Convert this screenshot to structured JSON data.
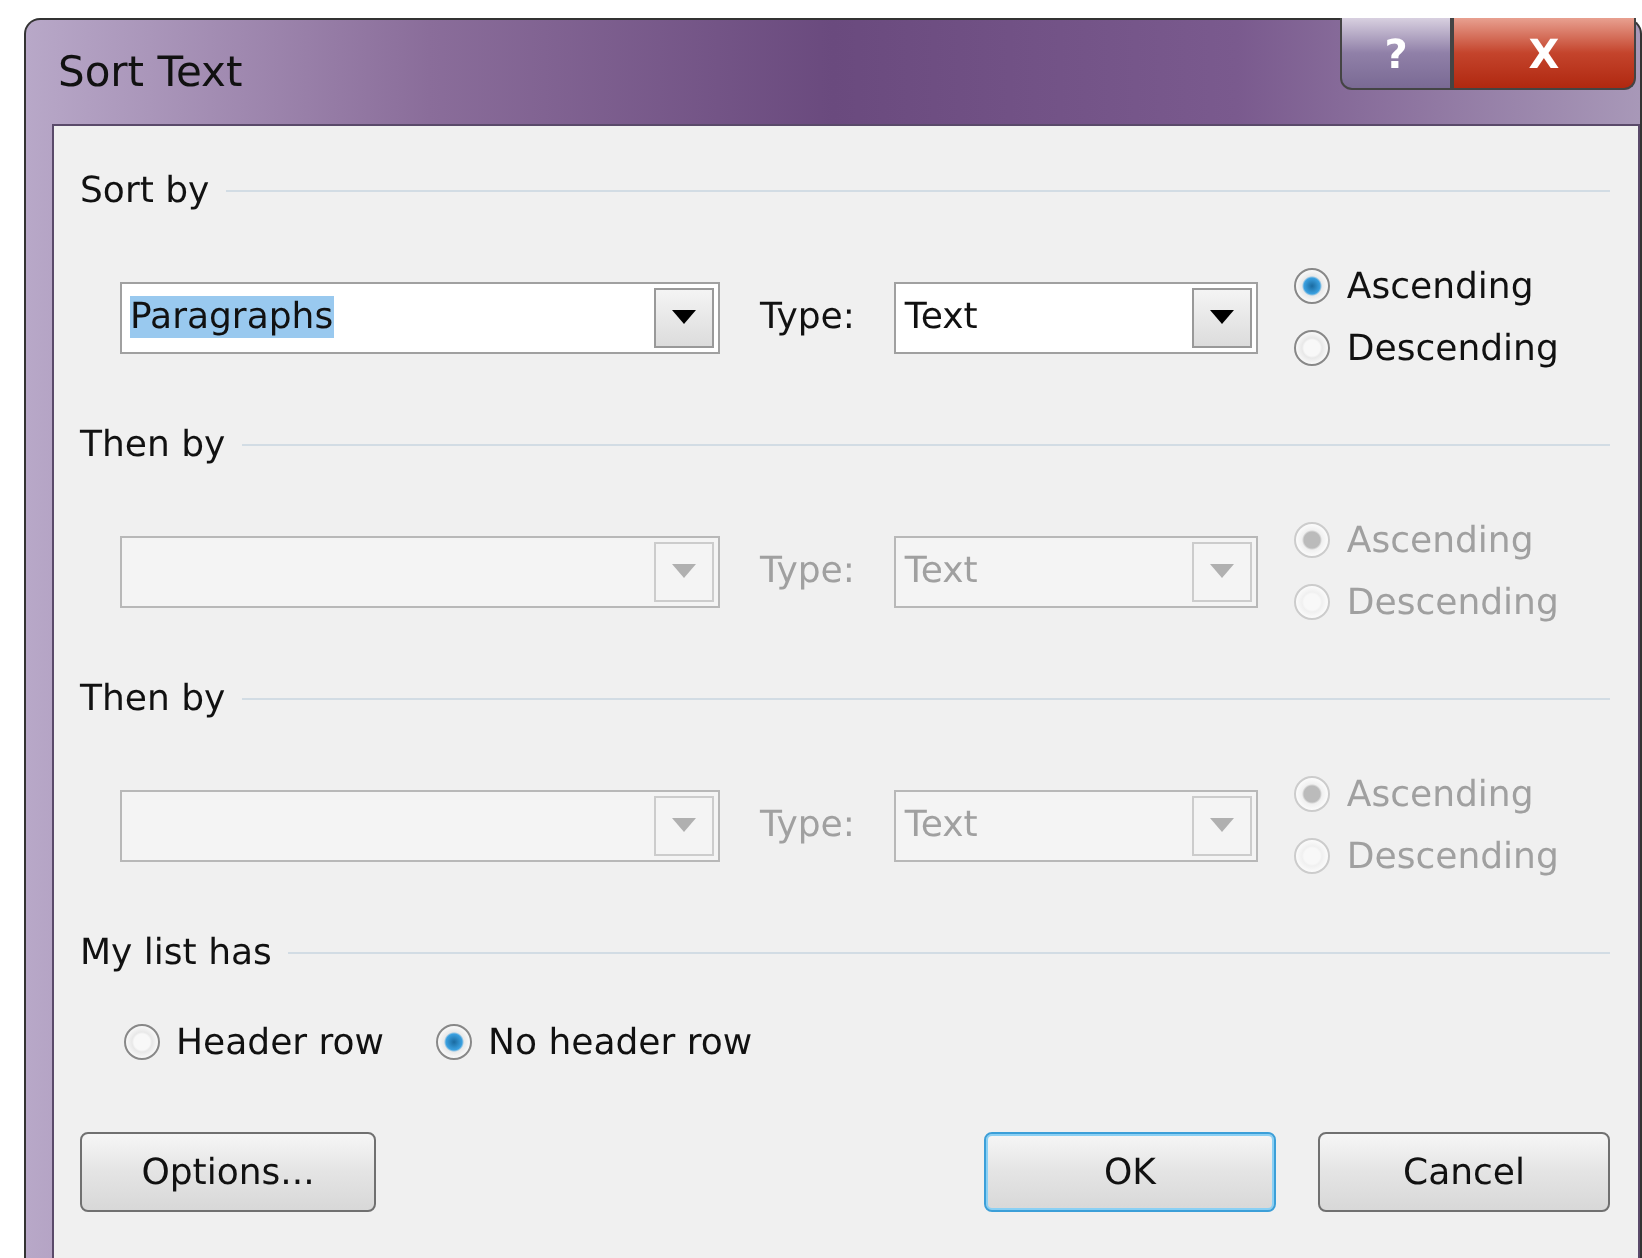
{
  "window": {
    "title": "Sort Text",
    "help": "?",
    "close": "X"
  },
  "sort_keys": [
    {
      "heading": "Sort by",
      "field": "Paragraphs",
      "field_selected": true,
      "type_label": "Type:",
      "type": "Text",
      "disabled": false,
      "order": [
        {
          "label": "Ascending",
          "selected": true
        },
        {
          "label": "Descending",
          "selected": false
        }
      ]
    },
    {
      "heading": "Then by",
      "type_label": "Type:",
      "type": "Text",
      "disabled": true,
      "order": [
        {
          "label": "Ascending",
          "selected": true
        },
        {
          "label": "Descending",
          "selected": false
        }
      ]
    },
    {
      "heading": "Then by",
      "type_label": "Type:",
      "type": "Text",
      "disabled": true,
      "order": [
        {
          "label": "Ascending",
          "selected": true
        },
        {
          "label": "Descending",
          "selected": false
        }
      ]
    }
  ],
  "list_has": {
    "heading": "My list has",
    "options": [
      {
        "label": "Header row",
        "selected": false
      },
      {
        "label": "No header row",
        "selected": true
      }
    ]
  },
  "buttons": [
    {
      "label": "Options...",
      "default": false
    },
    {
      "label": "OK",
      "default": true
    },
    {
      "label": "Cancel",
      "default": false
    }
  ]
}
